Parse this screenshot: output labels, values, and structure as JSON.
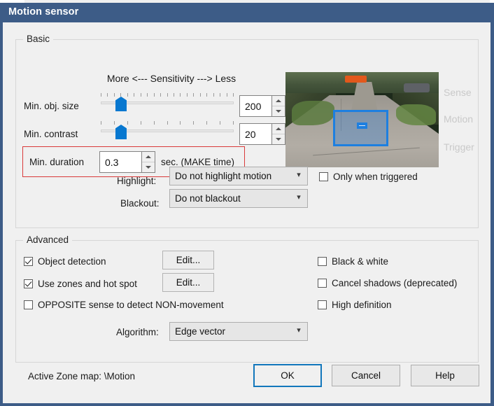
{
  "window": {
    "title": "Motion sensor",
    "titlebar_color": "#3d5c87"
  },
  "basic": {
    "legend": "Basic",
    "sensitivity_header": "More <--- Sensitivity ---> Less",
    "min_obj_size": {
      "label": "Min. obj. size",
      "value": "200",
      "slider_percent": 12,
      "tick_count": 21
    },
    "min_contrast": {
      "label": "Min. contrast",
      "value": "20",
      "slider_percent": 12,
      "tick_count": 11
    },
    "min_duration": {
      "label": "Min. duration",
      "value": "0.3",
      "unit": "sec.  (MAKE time)",
      "highlight_color": "#d93a3a"
    },
    "highlight": {
      "label": "Highlight:",
      "value": "Do not highlight motion",
      "arrow_icon": "chevron-down-icon"
    },
    "blackout": {
      "label": "Blackout:",
      "value": "Do not blackout",
      "arrow_icon": "chevron-down-icon"
    },
    "only_when_triggered": {
      "label": "Only when triggered",
      "checked": false
    },
    "preview": {
      "side_labels": [
        "Sense",
        "Motion",
        "Trigger"
      ]
    }
  },
  "advanced": {
    "legend": "Advanced",
    "object_detection": {
      "label": "Object detection",
      "checked": true
    },
    "object_detection_edit": "Edit...",
    "use_zones": {
      "label": "Use zones and hot spot",
      "checked": true
    },
    "use_zones_edit": "Edit...",
    "opposite_sense": {
      "label": "OPPOSITE sense to detect NON-movement",
      "checked": false
    },
    "black_white": {
      "label": "Black & white",
      "checked": false
    },
    "cancel_shadows": {
      "label": "Cancel shadows (deprecated)",
      "checked": false
    },
    "high_definition": {
      "label": "High definition",
      "checked": false
    },
    "algorithm": {
      "label": "Algorithm:",
      "value": "Edge vector",
      "arrow_icon": "chevron-down-icon"
    }
  },
  "footer": {
    "active_zone_map": "Active Zone map:  \\Motion",
    "ok": "OK",
    "cancel": "Cancel",
    "help": "Help",
    "default_button_color": "#1277bc"
  }
}
